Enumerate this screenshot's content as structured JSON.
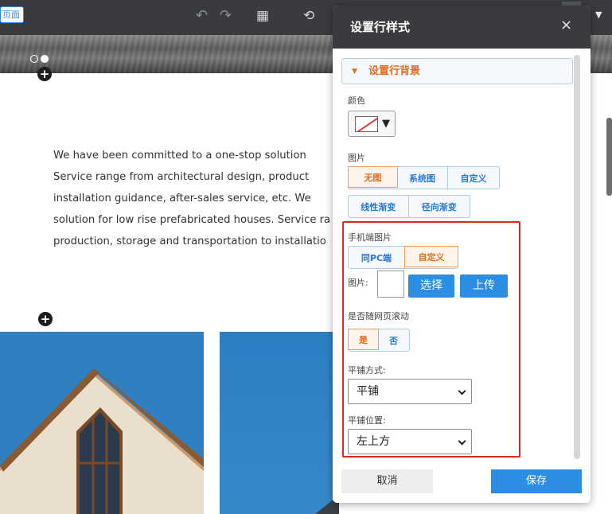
{
  "editor": {
    "page_chip": "页面",
    "paragraph_lines": [
      "We have been committed to a one-stop solution",
      "Service range from architectural design, product",
      "installation guidance, after-sales service, etc. We",
      "solution for low rise prefabricated houses. Service ra",
      "production, storage and transportation to installatio"
    ]
  },
  "dialog": {
    "title": "设置行样式",
    "close": "×",
    "section_title": "设置行背景",
    "color_label": "颜色",
    "image_label": "图片",
    "image_options": [
      "无图",
      "系统图",
      "自定义"
    ],
    "image_active": "无图",
    "gradient_options": [
      "线性渐变",
      "径向渐变"
    ],
    "mobile_image_label": "手机端图片",
    "mobile_options": [
      "同PC端",
      "自定义"
    ],
    "mobile_active": "自定义",
    "picture_label": "图片:",
    "select_button": "选择",
    "upload_button": "上传",
    "scroll_label": "是否随网页滚动",
    "scroll_options": [
      "是",
      "否"
    ],
    "scroll_active": "是",
    "tile_mode_label": "平铺方式:",
    "tile_mode_value": "平铺",
    "tile_position_label": "平铺位置:",
    "tile_position_value": "左上方",
    "cancel_button": "取消",
    "save_button": "保存"
  },
  "colors": {
    "accent_blue": "#2b8ee3",
    "accent_orange": "#e86a1c",
    "highlight_red": "#e5261f",
    "header_dark": "#393b3e"
  }
}
